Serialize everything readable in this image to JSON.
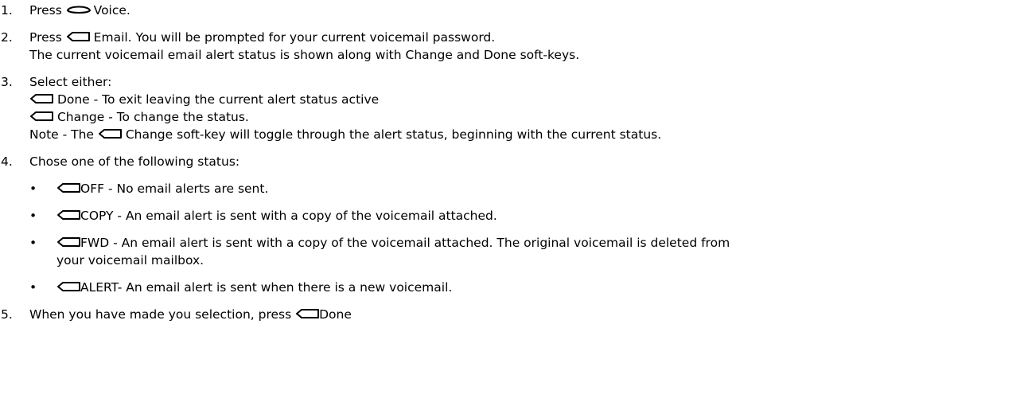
{
  "steps": [
    {
      "num": "1.",
      "pre": "Press",
      "post": "Voice."
    },
    {
      "num": "2.",
      "pre": "Press",
      "post": "Email. You will be prompted for your current voicemail password.",
      "line2": "The current voicemail email alert status is shown along with Change and Done soft-keys."
    },
    {
      "num": "3.",
      "intro": "Select either:",
      "opt1": "Done - To exit leaving the current alert status active",
      "opt2": "Change - To change the status.",
      "note_pre": "Note - The",
      "note_post": "Change soft-key will toggle through the alert status, beginning with the current status."
    },
    {
      "num": "4.",
      "intro": "Chose one of the following status:"
    },
    {
      "num": "5.",
      "pre": "When you have made you selection, press",
      "post": "Done"
    }
  ],
  "bullet_char": "•",
  "status_options": [
    {
      "text": "OFF - No email alerts are sent."
    },
    {
      "text": "COPY - An email alert is sent with a copy of the voicemail attached."
    },
    {
      "text": "FWD - An email alert is sent with a copy of the voicemail attached. The original voicemail is deleted from",
      "text2": "your voicemail mailbox."
    },
    {
      "text": "ALERT- An email alert is sent when there is a new voicemail."
    }
  ],
  "icons": {
    "soft_key": "soft-key-icon",
    "voice_key": "voice-key-icon"
  }
}
